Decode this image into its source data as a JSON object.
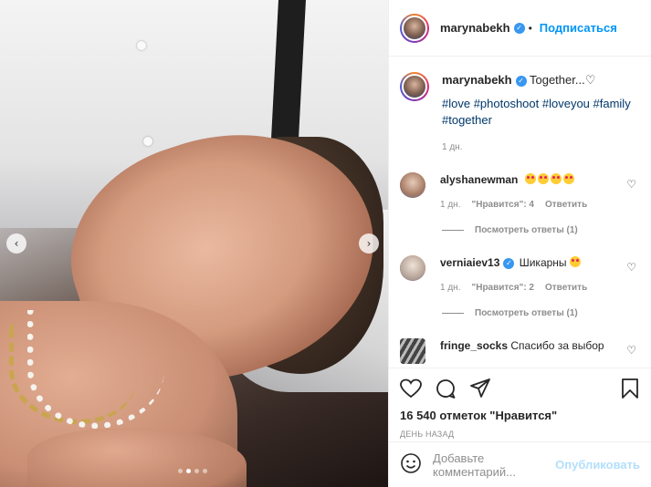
{
  "post": {
    "image_alt": "photo",
    "slide_dots": 4,
    "active_slide": 2,
    "nav_prev": "‹",
    "nav_next": "›"
  },
  "header": {
    "username": "marynabekh",
    "follow_label": "Подписаться",
    "separator": "•"
  },
  "caption": {
    "username": "marynabekh",
    "text": "Together...♡",
    "tags_line1": "#love #photoshoot #loveyou #family",
    "tags_line2": "#together",
    "time": "1 дн."
  },
  "comments": [
    {
      "username": "alyshanewman",
      "text": "",
      "emoji_count": 4,
      "time": "1 дн.",
      "likes": "\"Нравится\": 4",
      "reply": "Ответить",
      "view_replies": "Посмотреть ответы (1)"
    },
    {
      "username": "verniaiev13",
      "text": "Шикарны",
      "emoji_count": 1,
      "time": "1 дн.",
      "likes": "\"Нравится\": 2",
      "reply": "Ответить",
      "view_replies": "Посмотреть ответы (1)"
    },
    {
      "username": "fringe_socks",
      "text": "Спасибо за выбор"
    }
  ],
  "actions": {
    "likes_text": "16 540 отметок \"Нравится\"",
    "date_text": "ДЕНЬ НАЗАД"
  },
  "add_comment": {
    "placeholder": "Добавьте комментарий...",
    "publish_label": "Опубликовать"
  },
  "colors": {
    "link": "#0095f6",
    "publish_disabled": "#b2dffc",
    "hashtag": "#00376b",
    "muted": "#8e8e8e",
    "verified": "#3897f0"
  },
  "icons": {
    "verified": "checkmark-badge",
    "like": "heart-icon",
    "comment": "speech-bubble-icon",
    "share": "paper-plane-icon",
    "save": "bookmark-icon",
    "emoji": "smiley-icon"
  }
}
